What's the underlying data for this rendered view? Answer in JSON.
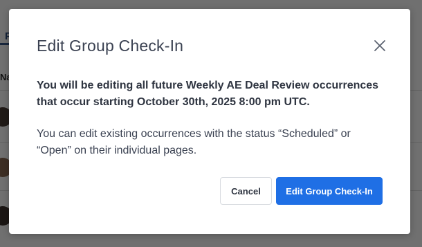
{
  "background": {
    "tab_label": "P",
    "column_header": "Na"
  },
  "modal": {
    "title": "Edit Group Check-In",
    "close_icon": "close-icon",
    "warning_text": "You will be editing all future Weekly AE Deal Review occurrences that occur starting October 30th, 2025 8:00 pm UTC.",
    "info_text": "You can edit existing occurrences with the status “Scheduled” or “Open” on their individual pages.",
    "cancel_label": "Cancel",
    "confirm_label": "Edit Group Check-In"
  },
  "colors": {
    "primary": "#1f6fe5",
    "overlay": "rgba(0,0,0,0.56)",
    "title": "#3b4252"
  }
}
